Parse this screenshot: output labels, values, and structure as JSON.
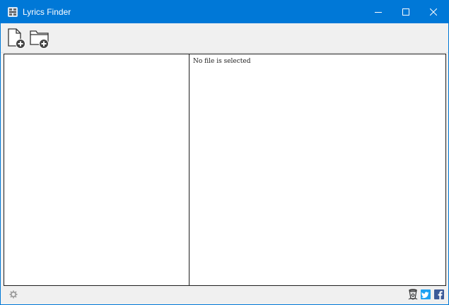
{
  "window": {
    "title": "Lyrics Finder",
    "accent_color": "#0078d7"
  },
  "toolbar": {
    "buttons": [
      {
        "icon": "add-file-icon"
      },
      {
        "icon": "add-folder-icon"
      }
    ]
  },
  "left_pane": {
    "items": []
  },
  "right_pane": {
    "status_text": "No file is selected"
  },
  "statusbar": {
    "icons": [
      "settings-icon",
      "bitbucket-icon",
      "twitter-icon",
      "facebook-icon"
    ],
    "colors": {
      "twitter": "#1da1f2",
      "facebook": "#3b5998"
    }
  }
}
